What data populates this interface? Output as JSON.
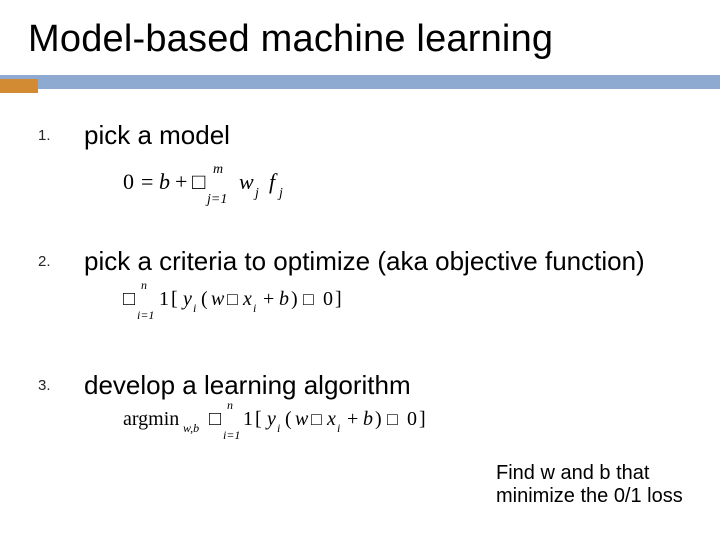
{
  "title": "Model-based machine learning",
  "items": [
    {
      "num": "1.",
      "text": "pick a model"
    },
    {
      "num": "2.",
      "text": "pick a criteria to optimize (aka objective function)"
    },
    {
      "num": "3.",
      "text": "develop a learning algorithm"
    }
  ],
  "formulas": {
    "model": {
      "lhs": "0",
      "eq": "=",
      "bias": "b",
      "plus": "+",
      "box": "□",
      "sub_j": "j=1",
      "sup_m": "m",
      "w": "w",
      "wj": "j",
      "f": "f",
      "fj": "j"
    },
    "objective": {
      "box": "□",
      "sub_i": "i=1",
      "sup_n": "n",
      "one": "1",
      "lbr": "[",
      "y": "y",
      "yi": "i",
      "lp": "(",
      "w": "w",
      "box2": "□",
      "x": "x",
      "xi": "i",
      "plus": "+",
      "b": "b",
      "rp": ")",
      "box3": "□",
      "zero": "0",
      "rbr": "]"
    },
    "learning": {
      "argmin": "argmin",
      "wb": "w,b",
      "box": "□",
      "sub_i": "i=1",
      "sup_n": "n",
      "one": "1",
      "lbr": "[",
      "y": "y",
      "yi": "i",
      "lp": "(",
      "w": "w",
      "box2": "□",
      "x": "x",
      "xi": "i",
      "plus": "+",
      "b": "b",
      "rp": ")",
      "box3": "□",
      "zero": "0",
      "rbr": "]"
    }
  },
  "note": "Find w and b that minimize the 0/1 loss"
}
